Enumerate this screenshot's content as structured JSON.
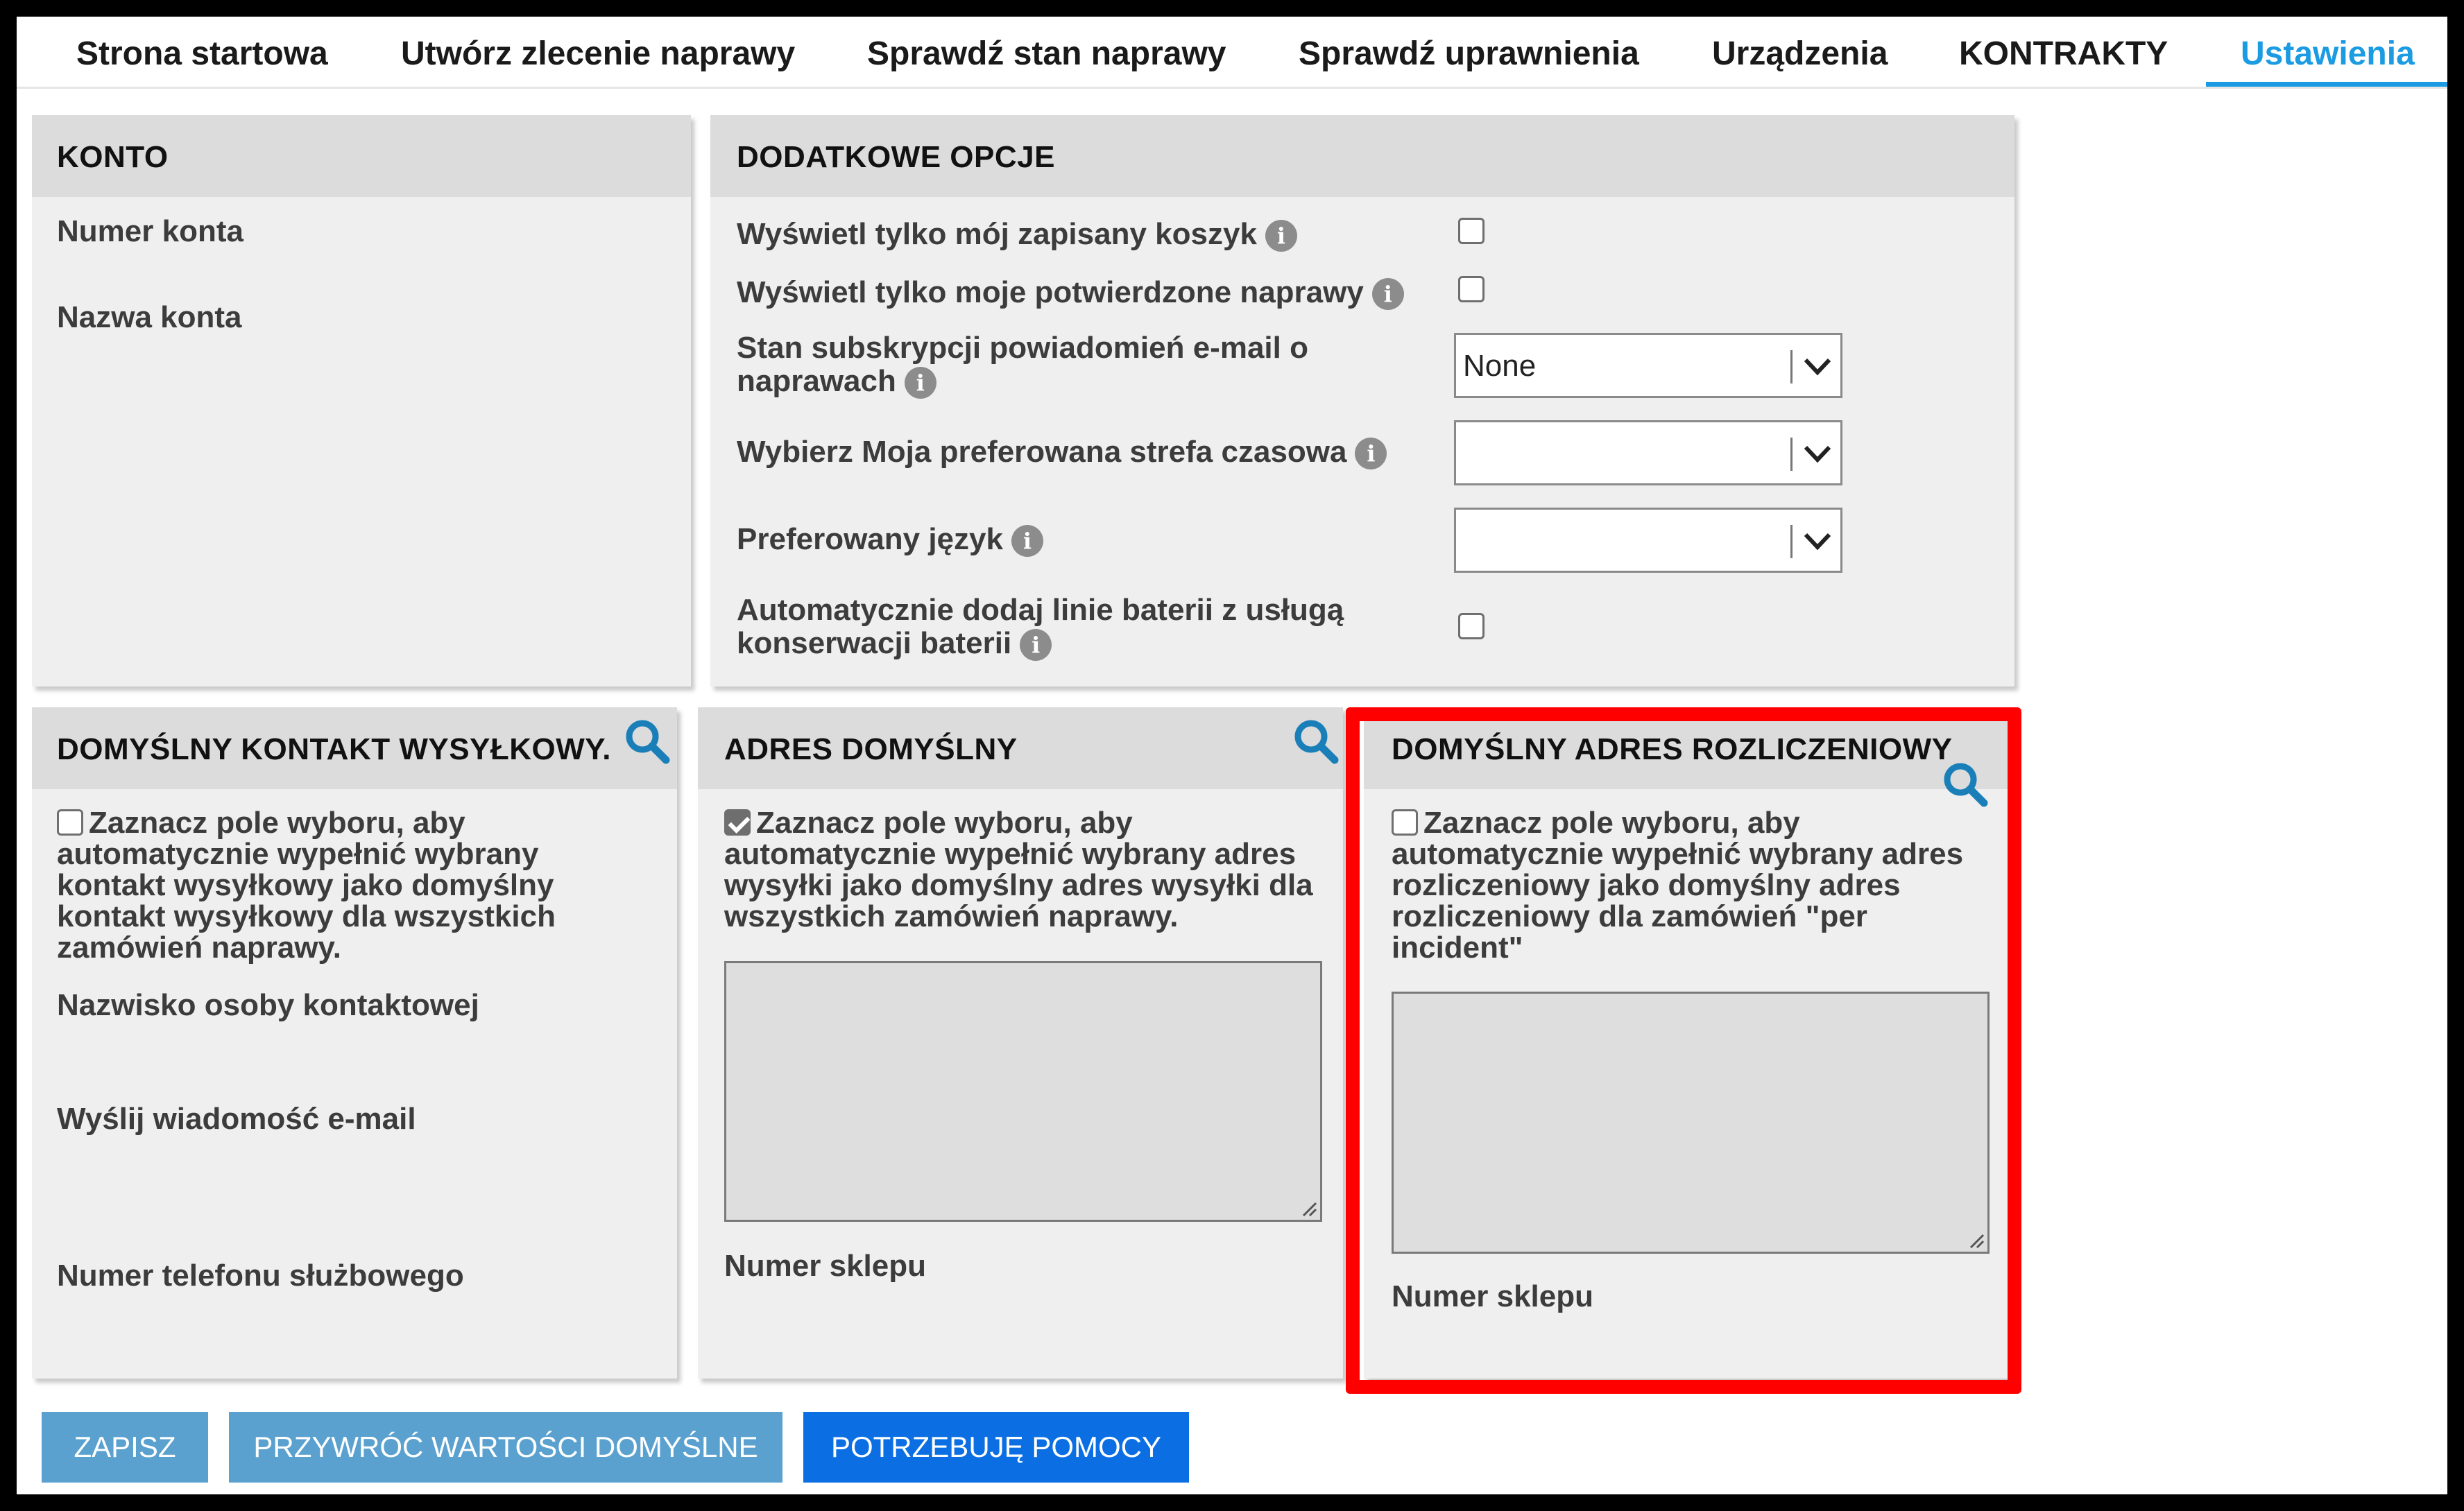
{
  "nav": {
    "tabs": [
      {
        "label": "Strona startowa"
      },
      {
        "label": "Utwórz zlecenie naprawy"
      },
      {
        "label": "Sprawdź stan naprawy"
      },
      {
        "label": "Sprawdź uprawnienia"
      },
      {
        "label": "Urządzenia"
      },
      {
        "label": "KONTRAKTY"
      },
      {
        "label": "Ustawienia",
        "active": true
      }
    ]
  },
  "konto": {
    "title": "KONTO",
    "account_number_label": "Numer konta",
    "account_name_label": "Nazwa konta"
  },
  "options": {
    "title": "DODATKOWE OPCJE",
    "items": [
      {
        "label": "Wyświetl tylko mój zapisany koszyk",
        "type": "checkbox",
        "checked": false
      },
      {
        "label": "Wyświetl tylko moje potwierdzone naprawy",
        "type": "checkbox",
        "checked": false
      },
      {
        "label": "Stan subskrypcji powiadomień e-mail o naprawach",
        "type": "select",
        "value": "None"
      },
      {
        "label": "Wybierz Moja preferowana strefa czasowa",
        "type": "select",
        "value": ""
      },
      {
        "label": "Preferowany język",
        "type": "select",
        "value": ""
      },
      {
        "label": "Automatycznie dodaj linie baterii z usługą konserwacji baterii",
        "type": "checkbox",
        "checked": false
      }
    ]
  },
  "shipping_contact": {
    "title": "DOMYŚLNY KONTAKT WYSYŁKOWY.",
    "checkbox_text": "Zaznacz pole wyboru, aby automatycznie wypełnić wybrany kontakt wysyłkowy jako domyślny kontakt wysyłkowy dla wszystkich zamówień naprawy.",
    "checked": false,
    "contact_name_label": "Nazwisko osoby kontaktowej",
    "email_label": "Wyślij wiadomość e-mail",
    "phone_label": "Numer telefonu służbowego"
  },
  "default_address": {
    "title": "ADRES DOMYŚLNY",
    "checkbox_text": "Zaznacz pole wyboru, aby automatycznie wypełnić wybrany adres wysyłki jako domyślny adres wysyłki dla wszystkich zamówień naprawy.",
    "checked": true,
    "address_value": "",
    "store_number_label": "Numer sklepu"
  },
  "billing_address": {
    "title": "DOMYŚLNY ADRES ROZLICZENIOWY",
    "checkbox_text": "Zaznacz pole wyboru, aby automatycznie wypełnić wybrany adres rozliczeniowy jako domyślny adres rozliczeniowy dla zamówień \"per incident\"",
    "checked": false,
    "address_value": "",
    "store_number_label": "Numer sklepu"
  },
  "buttons": {
    "save": "ZAPISZ",
    "restore": "PRZYWRÓĆ WARTOŚCI DOMYŚLNE",
    "help": "POTRZEBUJĘ POMOCY"
  },
  "colors": {
    "accent": "#1a9be2",
    "highlight": "#ff0000",
    "button_gray": "#5aa1cf",
    "button_blue": "#0b6fe3"
  }
}
